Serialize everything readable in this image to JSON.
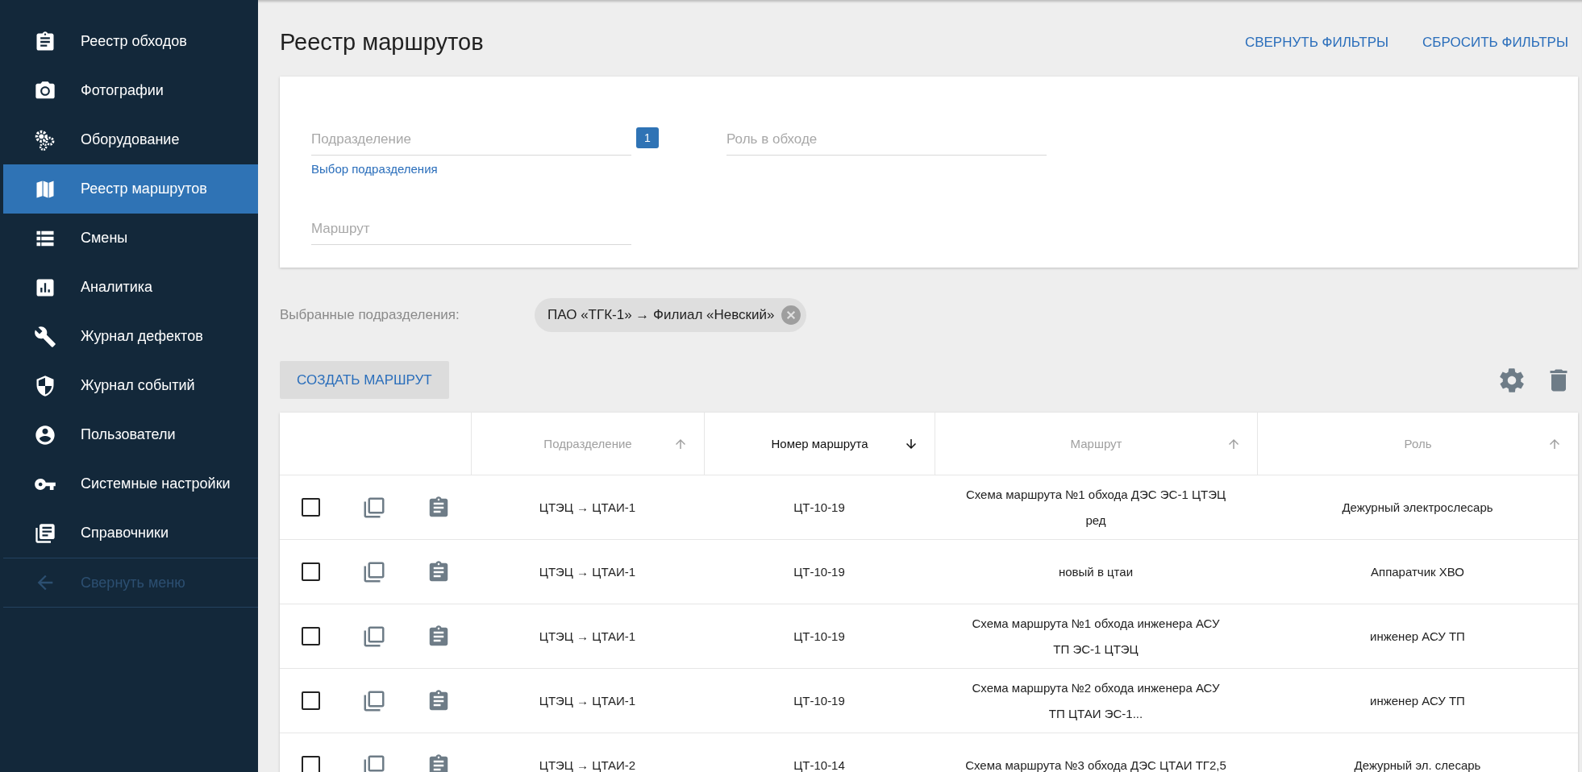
{
  "sidebar": {
    "items": [
      {
        "label": "Реестр обходов",
        "selected": false
      },
      {
        "label": "Фотографии",
        "selected": false
      },
      {
        "label": "Оборудование",
        "selected": false
      },
      {
        "label": "Реестр маршрутов",
        "selected": true
      },
      {
        "label": "Смены",
        "selected": false
      },
      {
        "label": "Аналитика",
        "selected": false
      },
      {
        "label": "Журнал дефектов",
        "selected": false
      },
      {
        "label": "Журнал событий",
        "selected": false
      },
      {
        "label": "Пользователи",
        "selected": false
      },
      {
        "label": "Системные настройки",
        "selected": false
      },
      {
        "label": "Справочники",
        "selected": false
      }
    ],
    "collapse": {
      "label": "Свернуть меню",
      "disabled": true
    }
  },
  "header": {
    "title": "Реестр маршрутов",
    "actions": [
      "СВЕРНУТЬ ФИЛЬТРЫ",
      "СБРОСИТЬ ФИЛЬТРЫ"
    ]
  },
  "filters": {
    "fields": [
      {
        "placeholder": "Подразделение",
        "badge": "1",
        "link": "Выбор подразделения"
      },
      {
        "placeholder": "Роль в обходе"
      },
      {
        "placeholder": "Маршрут"
      }
    ]
  },
  "selected_units": {
    "label": "Выбранные подразделения:",
    "chips": [
      "ПАО «ТГК-1» → Филиал «Невский»"
    ]
  },
  "toolbar": {
    "create_button": "СОЗДАТЬ МАРШРУТ"
  },
  "table": {
    "columns": [
      {
        "label": "Подразделение",
        "descending": false,
        "selected": false
      },
      {
        "label": "Номер маршрута",
        "descending": true,
        "selected": true
      },
      {
        "label": "Маршрут",
        "descending": false,
        "selected": false
      },
      {
        "label": "Роль",
        "descending": false,
        "selected": false
      }
    ],
    "rows": [
      {
        "checked": false,
        "cells": [
          "ЦТЭЦ → ЦТАИ-1",
          "ЦТ-10-19",
          "Схема маршрута №1 обхода ДЭС ЭС-1 ЦТЭЦ ред",
          "Дежурный электрослесарь"
        ]
      },
      {
        "checked": false,
        "cells": [
          "ЦТЭЦ → ЦТАИ-1",
          "ЦТ-10-19",
          "новый в цтаи",
          "Аппаратчик ХВО"
        ]
      },
      {
        "checked": false,
        "cells": [
          "ЦТЭЦ → ЦТАИ-1",
          "ЦТ-10-19",
          "Схема маршрута №1 обхода инженера АСУ ТП ЭС-1 ЦТЭЦ",
          "инженер АСУ ТП"
        ]
      },
      {
        "checked": false,
        "cells": [
          "ЦТЭЦ → ЦТАИ-1",
          "ЦТ-10-19",
          "Схема маршрута №2 обхода инженера АСУ ТП ЦТАИ ЭС-1...",
          "инженер АСУ ТП"
        ]
      },
      {
        "checked": false,
        "cells": [
          "ЦТЭЦ → ЦТАИ-2",
          "ЦТ-10-14",
          "Схема маршрута №3 обхода ДЭС ЦТАИ ТГ2,5",
          "Дежурный эл. слесарь"
        ]
      }
    ]
  }
}
